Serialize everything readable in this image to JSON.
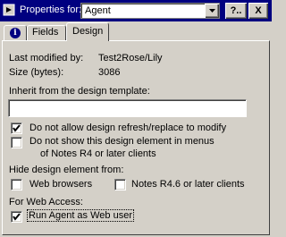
{
  "titlebar": {
    "label": "Properties for:",
    "selected": "Agent",
    "help_label": "?..",
    "close_label": "X"
  },
  "tabs": [
    {
      "label": "i",
      "icon": "info-icon",
      "active": false
    },
    {
      "label": "Fields",
      "active": false
    },
    {
      "label": "Design",
      "active": true
    }
  ],
  "info": {
    "modified_label": "Last modified by:",
    "modified_value": "Test2Rose/Lily",
    "size_label": "Size (bytes):",
    "size_value": "3086"
  },
  "inherit": {
    "label": "Inherit from the design template:",
    "value": ""
  },
  "options": {
    "no_refresh": {
      "label": "Do not allow design refresh/replace to modify",
      "checked": true
    },
    "no_show_menus": {
      "line1": "Do not show this design element in menus",
      "line2": "of Notes R4 or later clients",
      "checked": false
    }
  },
  "hide": {
    "label": "Hide design element from:",
    "web_browsers": {
      "label": "Web browsers",
      "checked": false
    },
    "notes_clients": {
      "label": "Notes R4.6 or later clients",
      "checked": false
    }
  },
  "web_access": {
    "label": "For Web Access:",
    "run_as_web_user": {
      "label": "Run Agent as Web user",
      "checked": true
    }
  },
  "colors": {
    "titlebar": "#000080",
    "face": "#d4d0c8"
  }
}
